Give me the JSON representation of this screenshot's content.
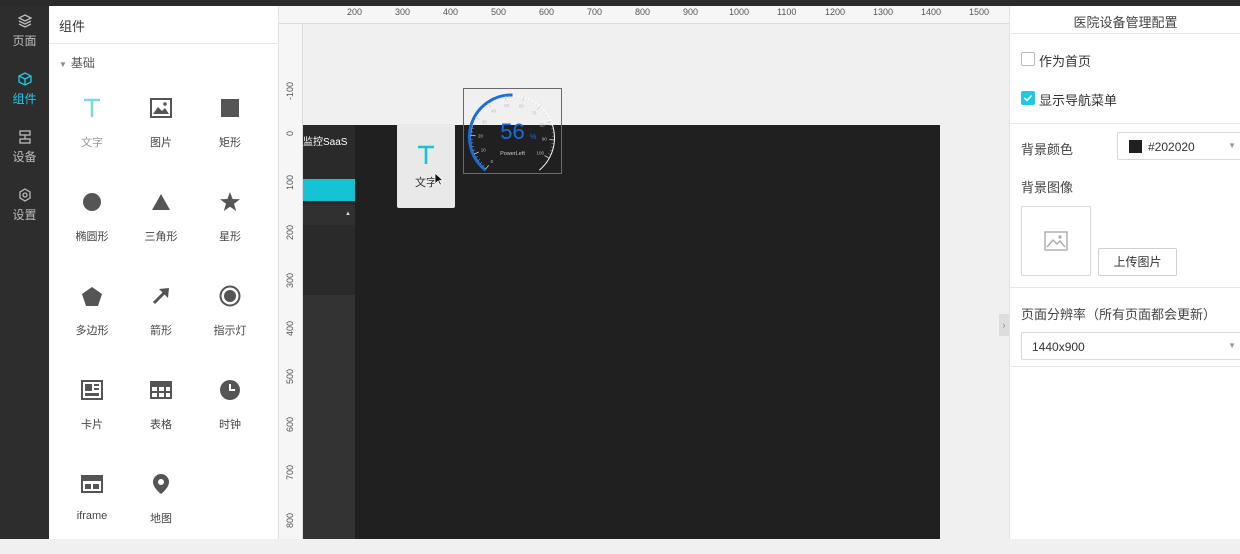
{
  "rail": {
    "items": [
      {
        "label": "页面",
        "icon": "layers-icon"
      },
      {
        "label": "组件",
        "icon": "cube-icon"
      },
      {
        "label": "设备",
        "icon": "device-icon"
      },
      {
        "label": "设置",
        "icon": "gear-icon"
      }
    ]
  },
  "components": {
    "title": "组件",
    "section": "基础",
    "items": [
      {
        "label": "文字",
        "icon": "text-icon"
      },
      {
        "label": "图片",
        "icon": "image-icon"
      },
      {
        "label": "矩形",
        "icon": "rectangle-icon"
      },
      {
        "label": "椭圆形",
        "icon": "circle-icon"
      },
      {
        "label": "三角形",
        "icon": "triangle-icon"
      },
      {
        "label": "星形",
        "icon": "star-icon"
      },
      {
        "label": "多边形",
        "icon": "pentagon-icon"
      },
      {
        "label": "箭形",
        "icon": "arrow-icon"
      },
      {
        "label": "指示灯",
        "icon": "indicator-icon"
      },
      {
        "label": "卡片",
        "icon": "card-icon"
      },
      {
        "label": "表格",
        "icon": "table-icon"
      },
      {
        "label": "时钟",
        "icon": "clock-icon"
      },
      {
        "label": "iframe",
        "icon": "iframe-icon"
      },
      {
        "label": "地图",
        "icon": "map-pin-icon"
      }
    ]
  },
  "canvas": {
    "ruler_top": [
      "200",
      "300",
      "400",
      "500",
      "600",
      "700",
      "800",
      "900",
      "1000",
      "1100",
      "1200",
      "1300",
      "1400",
      "1500"
    ],
    "ruler_left": [
      "-100",
      "0",
      "100",
      "200",
      "300",
      "400",
      "500",
      "600",
      "700",
      "800"
    ],
    "page_brand": "监控SaaS",
    "drag_label": "文字",
    "gauge": {
      "value": "56",
      "unit": "%",
      "label": "PowerLeft",
      "ticks": [
        "0",
        "10",
        "20",
        "30",
        "40",
        "50",
        "60",
        "70",
        "80",
        "90",
        "100"
      ]
    },
    "colors": {
      "page_bg": "#202020",
      "accent": "#16c3d4",
      "gauge": "#1a6bd8"
    }
  },
  "config": {
    "title": "医院设备管理配置",
    "home_label": "作为首页",
    "home_checked": false,
    "nav_label": "显示导航菜单",
    "nav_checked": true,
    "bg_color_label": "背景颜色",
    "bg_color_value": "#202020",
    "bg_image_label": "背景图像",
    "upload_label": "上传图片",
    "resolution_label": "页面分辨率（所有页面都会更新）",
    "resolution_value": "1440x900"
  }
}
